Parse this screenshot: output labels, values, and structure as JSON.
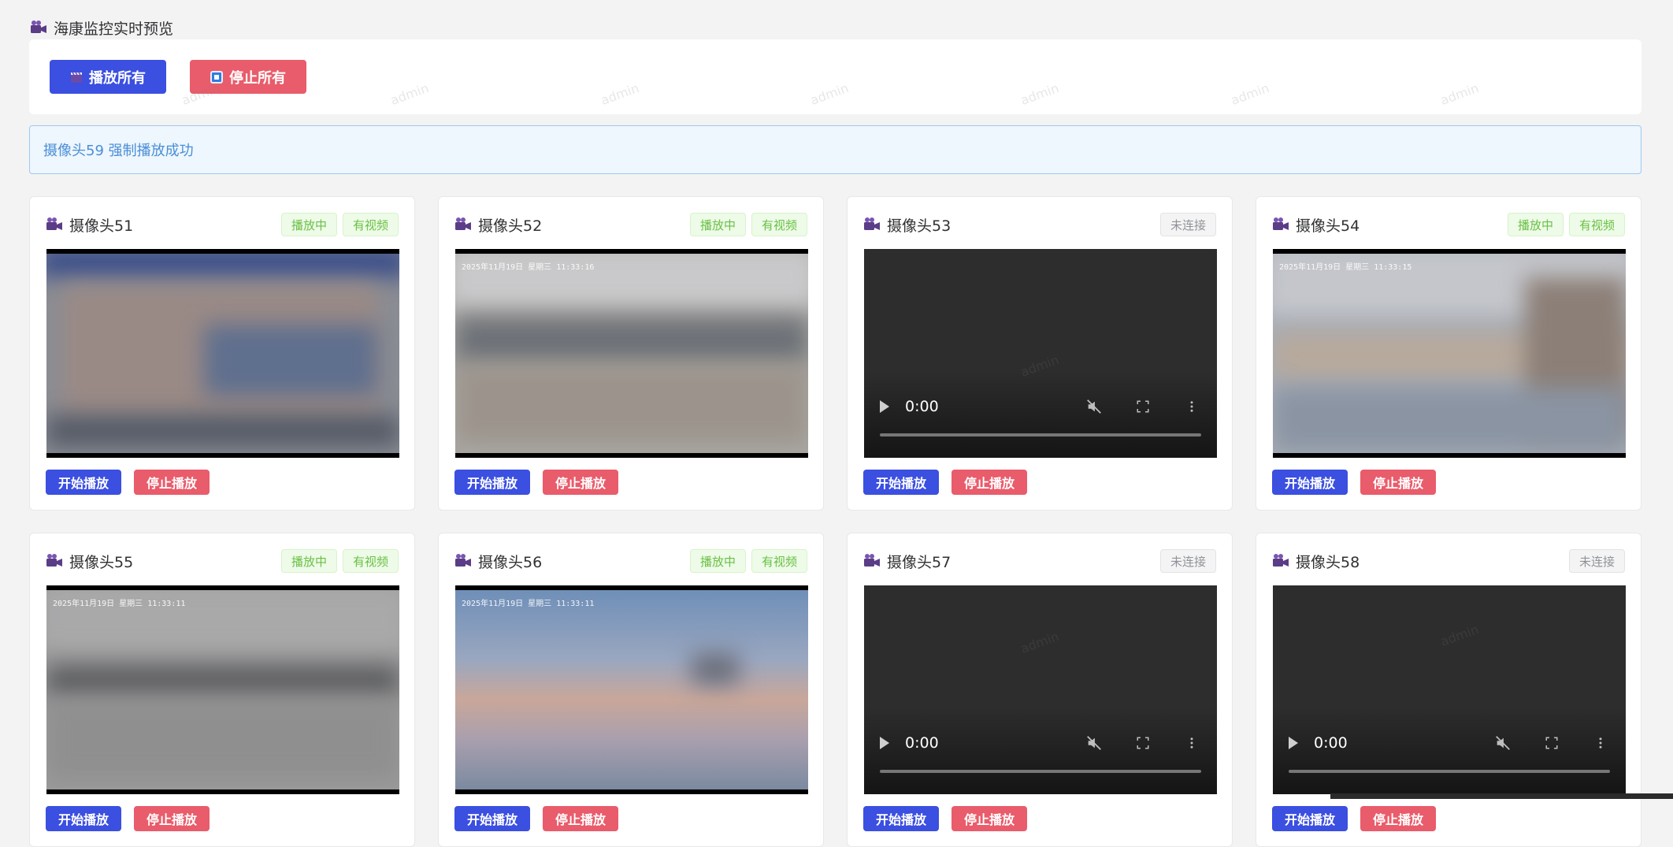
{
  "page": {
    "title": "海康监控实时预览",
    "watermark": "admin"
  },
  "toolbar": {
    "play_all": "播放所有",
    "stop_all": "停止所有"
  },
  "alert": {
    "message": "摄像头59 强制播放成功"
  },
  "colors": {
    "primary": "#3b4fe0",
    "danger": "#e95c6b",
    "success_tag": "#6ac045",
    "info": "#4a8fd6"
  },
  "cameras": [
    {
      "name": "摄像头51",
      "tags": [
        "播放中",
        "有视频"
      ],
      "status": "playing",
      "osd": "",
      "start_label": "开始播放",
      "stop_label": "停止播放"
    },
    {
      "name": "摄像头52",
      "tags": [
        "播放中",
        "有视频"
      ],
      "status": "playing",
      "osd": "2025年11月19日 星期三 11:33:16",
      "start_label": "开始播放",
      "stop_label": "停止播放"
    },
    {
      "name": "摄像头53",
      "tags": [
        "未连接"
      ],
      "status": "disconnected",
      "time": "0:00",
      "start_label": "开始播放",
      "stop_label": "停止播放"
    },
    {
      "name": "摄像头54",
      "tags": [
        "播放中",
        "有视频"
      ],
      "status": "playing",
      "osd": "2025年11月19日 星期三 11:33:15",
      "start_label": "开始播放",
      "stop_label": "停止播放"
    },
    {
      "name": "摄像头55",
      "tags": [
        "播放中",
        "有视频"
      ],
      "status": "playing",
      "osd": "2025年11月19日 星期三 11:33:11",
      "start_label": "开始播放",
      "stop_label": "停止播放"
    },
    {
      "name": "摄像头56",
      "tags": [
        "播放中",
        "有视频"
      ],
      "status": "playing",
      "osd": "2025年11月19日 星期三 11:33:11",
      "start_label": "开始播放",
      "stop_label": "停止播放"
    },
    {
      "name": "摄像头57",
      "tags": [
        "未连接"
      ],
      "status": "disconnected",
      "time": "0:00",
      "start_label": "开始播放",
      "stop_label": "停止播放"
    },
    {
      "name": "摄像头58",
      "tags": [
        "未连接"
      ],
      "status": "disconnected",
      "time": "0:00",
      "start_label": "开始播放",
      "stop_label": "停止播放"
    }
  ]
}
